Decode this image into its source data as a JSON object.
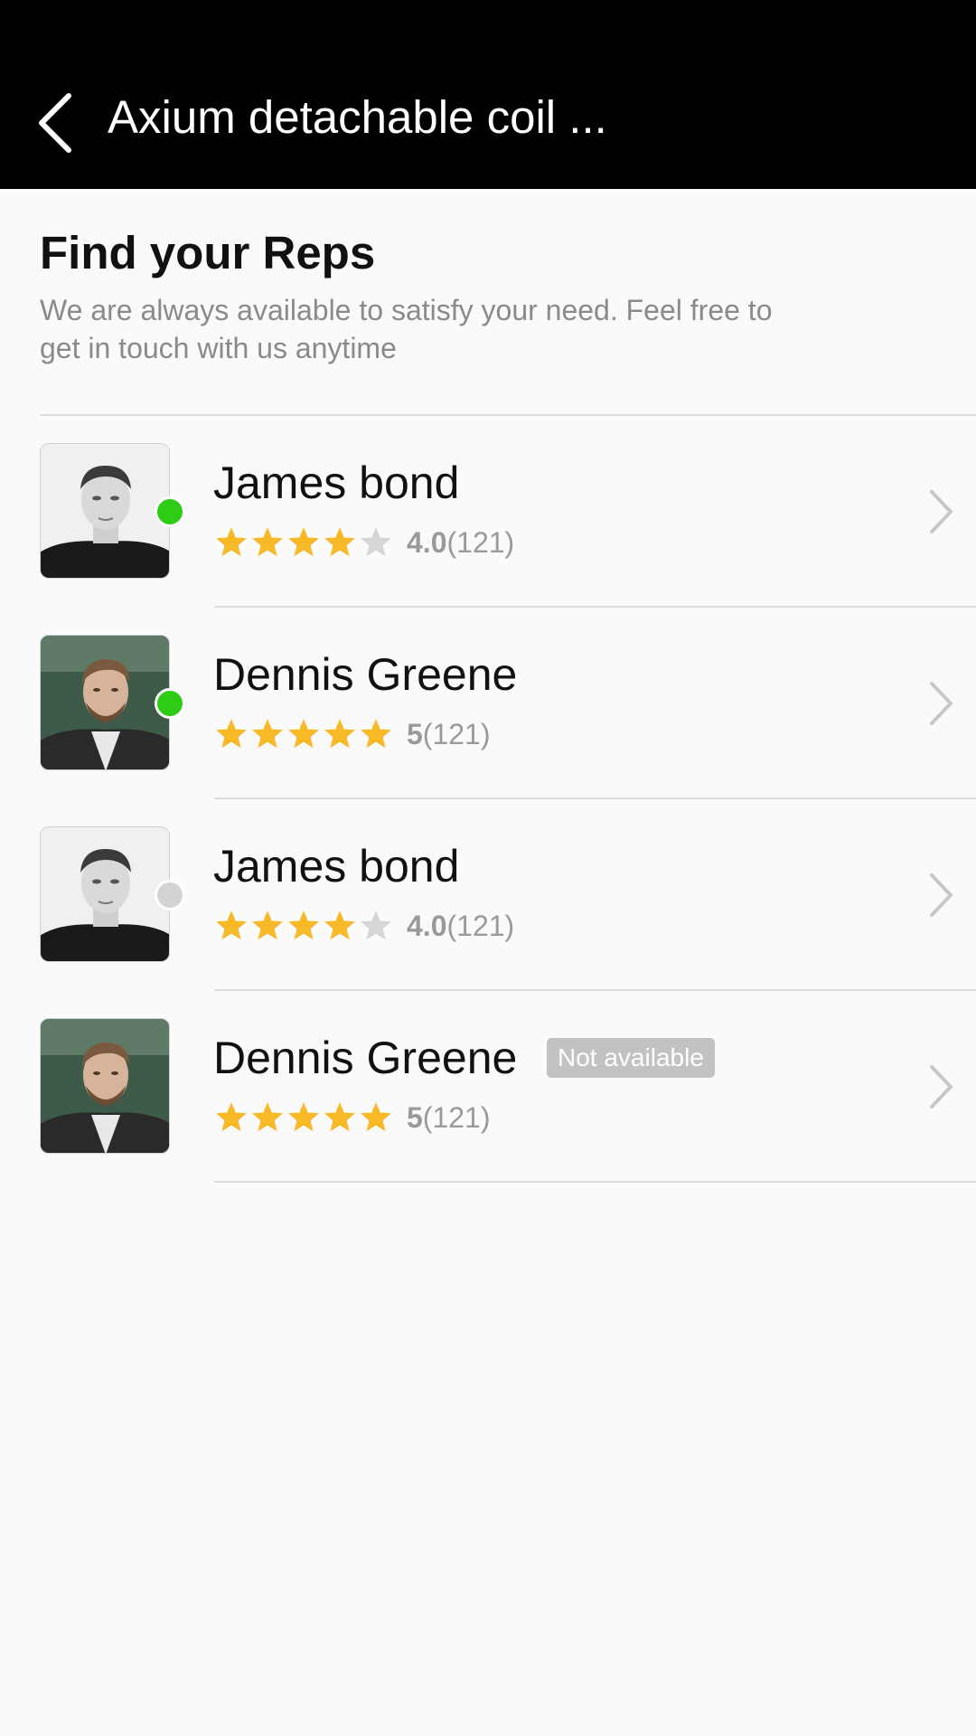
{
  "header": {
    "title": "Axium detachable coil ..."
  },
  "intro": {
    "title": "Find your Reps",
    "description": "We are always available to satisfy your need. Feel free to get in touch with us anytime"
  },
  "colors": {
    "online": "#2fcc16",
    "offline": "#d3d3d3",
    "star_filled": "#f7b928",
    "star_empty": "#d6d6d6",
    "badge_bg": "#c2c2c2"
  },
  "reps": [
    {
      "name": "James bond",
      "rating_value": "4.0",
      "rating_count": "(121)",
      "stars": 4,
      "status": "online",
      "badge": "",
      "avatar": "dark-portrait"
    },
    {
      "name": "Dennis Greene",
      "rating_value": "5",
      "rating_count": "(121)",
      "stars": 5,
      "status": "online",
      "badge": "",
      "avatar": "outdoor-portrait"
    },
    {
      "name": "James bond",
      "rating_value": "4.0",
      "rating_count": "(121)",
      "stars": 4,
      "status": "offline",
      "badge": "",
      "avatar": "dark-portrait"
    },
    {
      "name": "Dennis Greene",
      "rating_value": "5",
      "rating_count": "(121)",
      "stars": 5,
      "status": "none",
      "badge": "Not available",
      "avatar": "outdoor-portrait"
    }
  ]
}
